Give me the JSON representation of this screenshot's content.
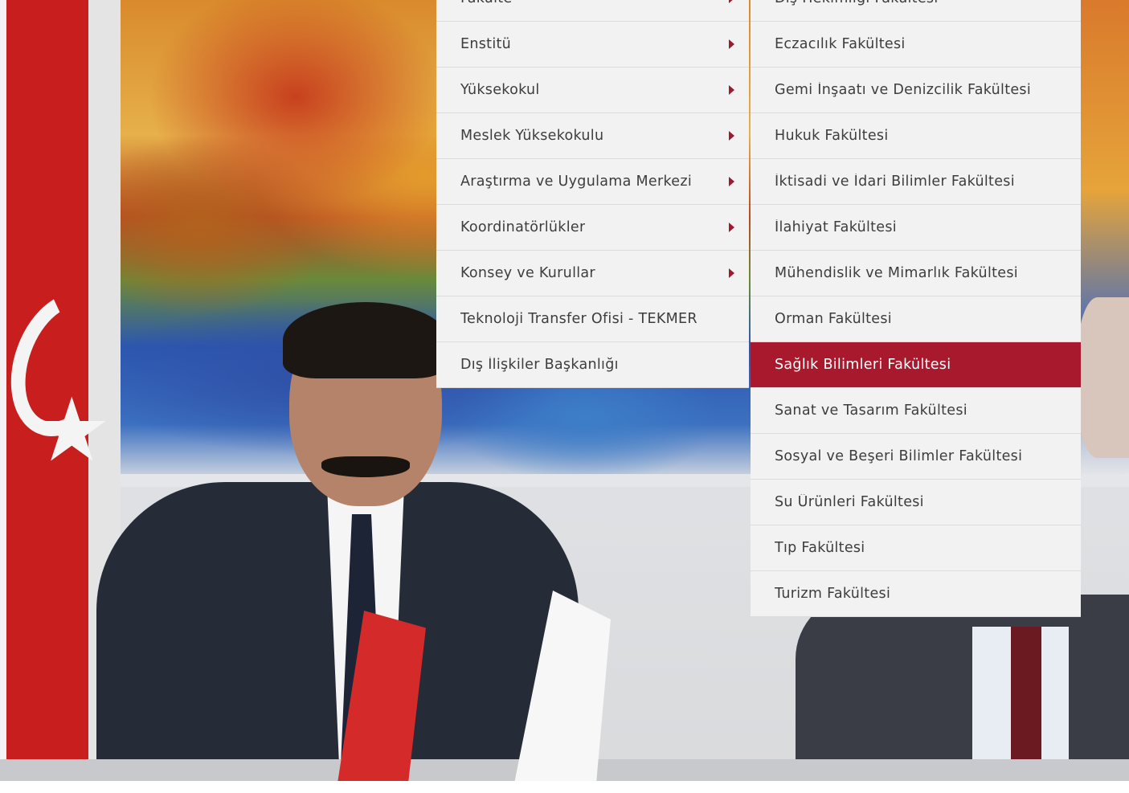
{
  "menu": {
    "left_items": [
      {
        "label": "Fakülte",
        "has_submenu": true
      },
      {
        "label": "Enstitü",
        "has_submenu": true
      },
      {
        "label": "Yüksekokul",
        "has_submenu": true
      },
      {
        "label": "Meslek Yüksekokulu",
        "has_submenu": true
      },
      {
        "label": "Araştırma ve Uygulama Merkezi",
        "has_submenu": true
      },
      {
        "label": "Koordinatörlükler",
        "has_submenu": true
      },
      {
        "label": "Konsey ve Kurullar",
        "has_submenu": true
      },
      {
        "label": "Teknoloji Transfer Ofisi - TEKMER",
        "has_submenu": false
      },
      {
        "label": "Dış İlişkiler Başkanlığı",
        "has_submenu": false
      }
    ],
    "right_items": [
      {
        "label": "Diş Hekimliği Fakültesi",
        "active": false
      },
      {
        "label": "Eczacılık Fakültesi",
        "active": false
      },
      {
        "label": "Gemi İnşaatı ve Denizcilik Fakültesi",
        "active": false
      },
      {
        "label": "Hukuk Fakültesi",
        "active": false
      },
      {
        "label": "İktisadi ve İdari Bilimler Fakültesi",
        "active": false
      },
      {
        "label": "İlahiyat Fakültesi",
        "active": false
      },
      {
        "label": "Mühendislik ve Mimarlık Fakültesi",
        "active": false
      },
      {
        "label": "Orman Fakültesi",
        "active": false
      },
      {
        "label": "Sağlık Bilimleri Fakültesi",
        "active": true
      },
      {
        "label": "Sanat ve Tasarım Fakültesi",
        "active": false
      },
      {
        "label": "Sosyal ve Beşeri Bilimler Fakültesi",
        "active": false
      },
      {
        "label": "Su Ürünleri Fakültesi",
        "active": false
      },
      {
        "label": "Tıp Fakültesi",
        "active": false
      },
      {
        "label": "Turizm Fakültesi",
        "active": false
      }
    ]
  },
  "colors": {
    "accent": "#a8192d",
    "menu_bg": "#f2f2f2",
    "menu_text": "#3d3d3d",
    "active_text": "#ffffff"
  },
  "icons": {
    "submenu_arrow": "caret-right-icon"
  }
}
